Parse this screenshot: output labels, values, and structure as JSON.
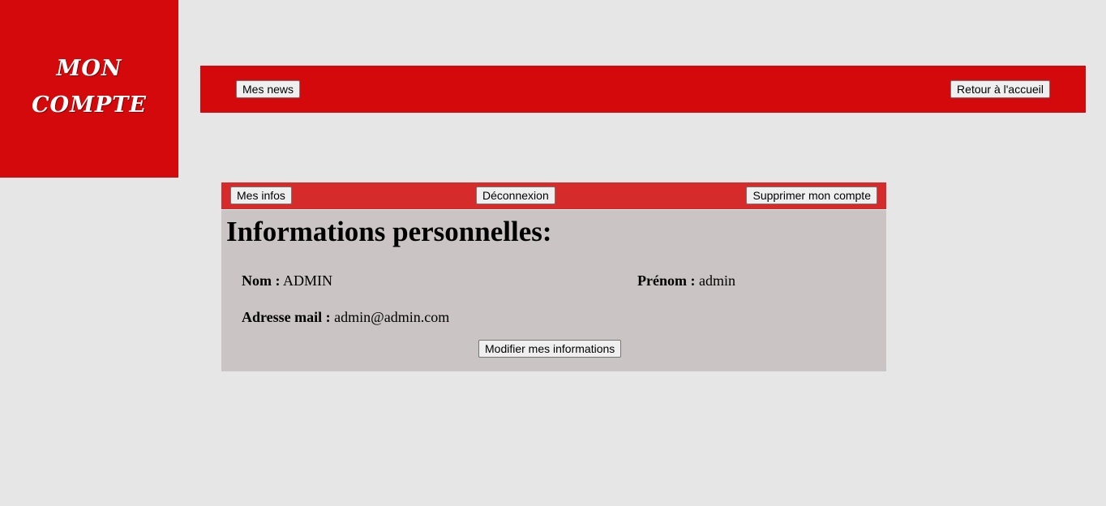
{
  "logo": {
    "line1": "Mon",
    "line2": "Compte"
  },
  "topbar": {
    "news_label": "Mes news",
    "home_label": "Retour à l'accueil"
  },
  "account_bar": {
    "infos_label": "Mes infos",
    "logout_label": "Déconnexion",
    "delete_label": "Supprimer mon compte"
  },
  "info": {
    "title": "Informations personnelles:",
    "nom_label": "Nom :",
    "nom_value": "ADMIN",
    "prenom_label": "Prénom :",
    "prenom_value": "admin",
    "mail_label": "Adresse mail :",
    "mail_value": "admin@admin.com",
    "edit_label": "Modifier mes informations"
  },
  "colors": {
    "brand_red": "#d4090b",
    "bar_red": "#d62b2b",
    "panel_bg": "#cbc4c4",
    "page_bg": "#e6e6e6"
  }
}
